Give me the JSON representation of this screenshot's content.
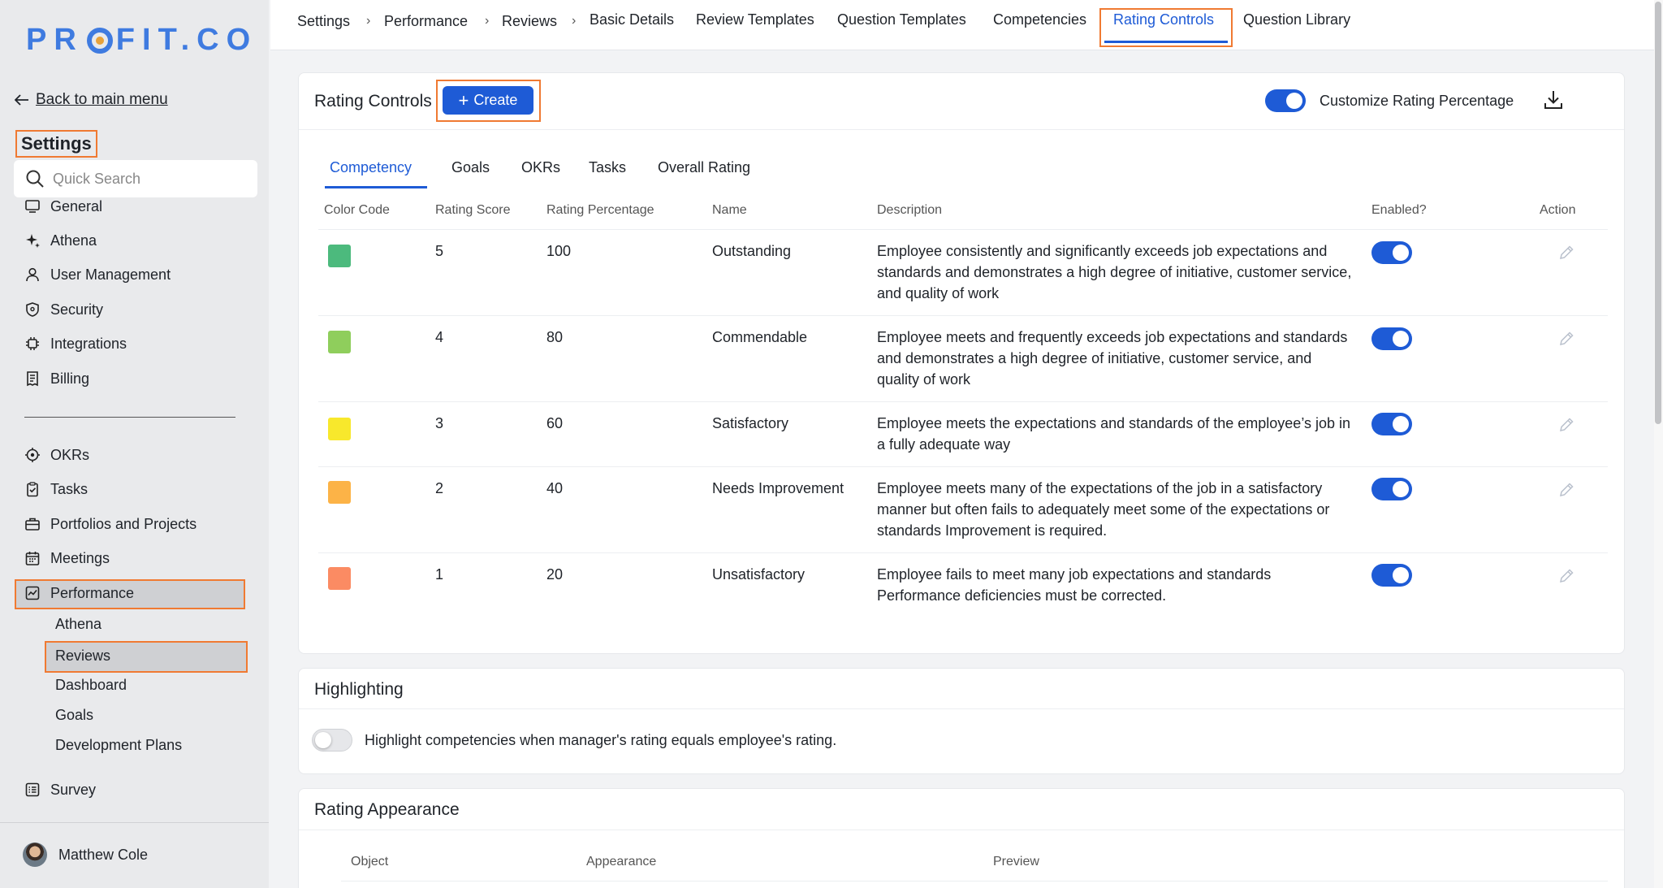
{
  "sidebar": {
    "logo": {
      "left": "PR",
      "right": "FIT.CO"
    },
    "back_label": "Back to main menu",
    "title": "Settings",
    "search_placeholder": "Quick Search",
    "items": [
      {
        "label": "General",
        "icon": "monitor-icon"
      },
      {
        "label": "Athena",
        "icon": "sparkle-icon"
      },
      {
        "label": "User Management",
        "icon": "user-icon"
      },
      {
        "label": "Security",
        "icon": "shield-icon"
      },
      {
        "label": "Integrations",
        "icon": "chip-icon"
      },
      {
        "label": "Billing",
        "icon": "receipt-icon"
      }
    ],
    "modules": [
      {
        "label": "OKRs",
        "icon": "target-icon"
      },
      {
        "label": "Tasks",
        "icon": "clipboard-check-icon"
      },
      {
        "label": "Portfolios and Projects",
        "icon": "briefcase-icon"
      },
      {
        "label": "Meetings",
        "icon": "calendar-icon"
      },
      {
        "label": "Performance",
        "icon": "chart-icon"
      }
    ],
    "performance_sub": [
      "Athena",
      "Reviews",
      "Dashboard",
      "Goals",
      "Development Plans"
    ],
    "survey": {
      "label": "Survey",
      "icon": "survey-icon"
    },
    "user": {
      "name": "Matthew Cole"
    }
  },
  "topnav": {
    "breadcrumbs": [
      "Settings",
      "Performance",
      "Reviews"
    ],
    "tabs": [
      "Basic Details",
      "Review Templates",
      "Question Templates",
      "Competencies",
      "Rating Controls",
      "Question Library"
    ],
    "active_tab": "Rating Controls"
  },
  "rating_controls": {
    "title": "Rating Controls",
    "create_label": "Create",
    "customize_label": "Customize Rating Percentage",
    "customize_enabled": true,
    "subtabs": [
      "Competency",
      "Goals",
      "OKRs",
      "Tasks",
      "Overall Rating"
    ],
    "active_subtab": "Competency",
    "columns": {
      "color": "Color Code",
      "score": "Rating Score",
      "percentage": "Rating Percentage",
      "name": "Name",
      "description": "Description",
      "enabled": "Enabled?",
      "action": "Action"
    },
    "rows": [
      {
        "color": "#4cba7d",
        "score": "5",
        "percentage": "100",
        "name": "Outstanding",
        "description": "Employee consistently and significantly exceeds job expectations and standards and demonstrates a high degree of initiative, customer service, and quality of work",
        "enabled": true
      },
      {
        "color": "#8fce5c",
        "score": "4",
        "percentage": "80",
        "name": "Commendable",
        "description": "Employee meets and frequently exceeds job expectations and standards and demonstrates a high degree of initiative, customer service, and quality of work",
        "enabled": true
      },
      {
        "color": "#f8e82c",
        "score": "3",
        "percentage": "60",
        "name": "Satisfactory",
        "description": "Employee meets the expectations and standards of the employee’s job in a fully adequate way",
        "enabled": true
      },
      {
        "color": "#fcb347",
        "score": "2",
        "percentage": "40",
        "name": "Needs Improvement",
        "description": "Employee meets many of the expectations of the job in a satisfactory manner but often fails to adequately meet some of the expectations or standards Improvement is required.",
        "enabled": true
      },
      {
        "color": "#fb8b63",
        "score": "1",
        "percentage": "20",
        "name": "Unsatisfactory",
        "description": "Employee fails to meet many job expectations and standards Performance deficiencies must be corrected.",
        "enabled": true
      }
    ]
  },
  "highlighting": {
    "title": "Highlighting",
    "toggle_label": "Highlight competencies when manager's rating equals employee's rating.",
    "enabled": false
  },
  "rating_appearance": {
    "title": "Rating Appearance",
    "columns": [
      "Object",
      "Appearance",
      "Preview"
    ]
  }
}
